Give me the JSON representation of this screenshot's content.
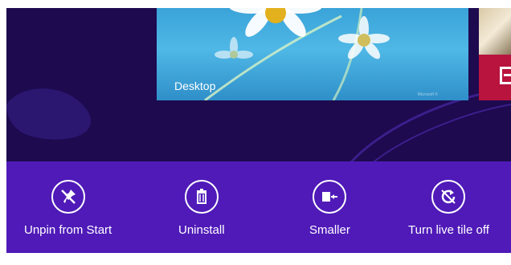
{
  "tiles": {
    "desktop": {
      "label": "Desktop",
      "watermark": "Microsoft ©"
    }
  },
  "app_bar": {
    "commands": [
      {
        "label": "Unpin from Start",
        "icon": "unpin-icon"
      },
      {
        "label": "Uninstall",
        "icon": "trash-icon"
      },
      {
        "label": "Smaller",
        "icon": "smaller-icon"
      },
      {
        "label": "Turn live tile off",
        "icon": "live-tile-off-icon"
      }
    ]
  },
  "colors": {
    "start_background": "#1d0a4f",
    "app_bar": "#4f1ab8",
    "desktop_tile": "#3aa3d8",
    "red_tile": "#b8143e"
  }
}
